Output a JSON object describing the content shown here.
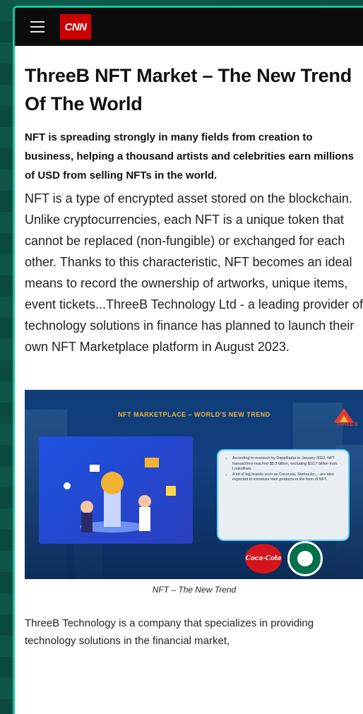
{
  "header": {
    "logo_text": "CNN",
    "brand_color": "#cc0000"
  },
  "article": {
    "title": "ThreeB NFT Market – The New Trend Of The World",
    "lead": "NFT is spreading strongly in many fields from creation to business, helping a thousand artists and celebrities earn millions of USD from selling NFTs in the world.",
    "paragraph1": "NFT is a type of encrypted asset stored on the blockchain. Unlike cryptocurrencies, each NFT is a unique token that cannot be replaced (non-fungible) or exchanged for each other. Thanks to this characteristic, NFT becomes an ideal means to record the ownership of artworks, unique items, event tickets...ThreeB Technology Ltd - a leading provider of technology solutions in finance has planned to launch their own NFT Marketplace platform in August 2023.",
    "paragraph2": "ThreeB Technology is a company that specializes in providing technology solutions in the financial market,"
  },
  "figure": {
    "banner_title": "NFT MARKETPLACE – WORLD'S NEW TREND",
    "brand_text": "THREE B",
    "bullets": [
      "According to research by DappRadar in January 2022, NFT transactions reached $5.3 billion, excluding $10.7 billion from LooksRare.",
      "A lot of big brands such as Cococola, Starbucks,... are also expected to introduce their products in the form of NFT."
    ],
    "coke_text": "Coca-Cola",
    "caption": "NFT – The New Trend"
  }
}
